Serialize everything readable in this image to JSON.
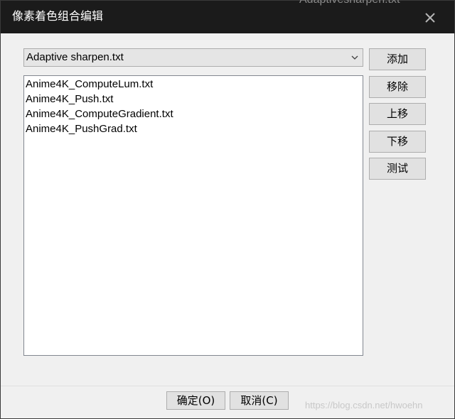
{
  "window": {
    "title": "像素着色组合编辑",
    "background_text": "Adaptivesharpen.txt"
  },
  "combo": {
    "selected": "Adaptive sharpen.txt"
  },
  "list": {
    "items": [
      "Anime4K_ComputeLum.txt",
      "Anime4K_Push.txt",
      "Anime4K_ComputeGradient.txt",
      "Anime4K_PushGrad.txt"
    ]
  },
  "buttons": {
    "add": "添加",
    "remove": "移除",
    "move_up": "上移",
    "move_down": "下移",
    "test": "测试",
    "ok": "确定(O)",
    "cancel": "取消(C)"
  },
  "watermark": "https://blog.csdn.net/hwoehn",
  "colors": {
    "titlebar": "#1b1b1b",
    "dialog_bg": "#f0f0f0",
    "button_bg": "#e1e1e1",
    "list_bg": "#ffffff"
  },
  "icons": {
    "close": "close-icon",
    "dropdown": "chevron-down-icon"
  }
}
